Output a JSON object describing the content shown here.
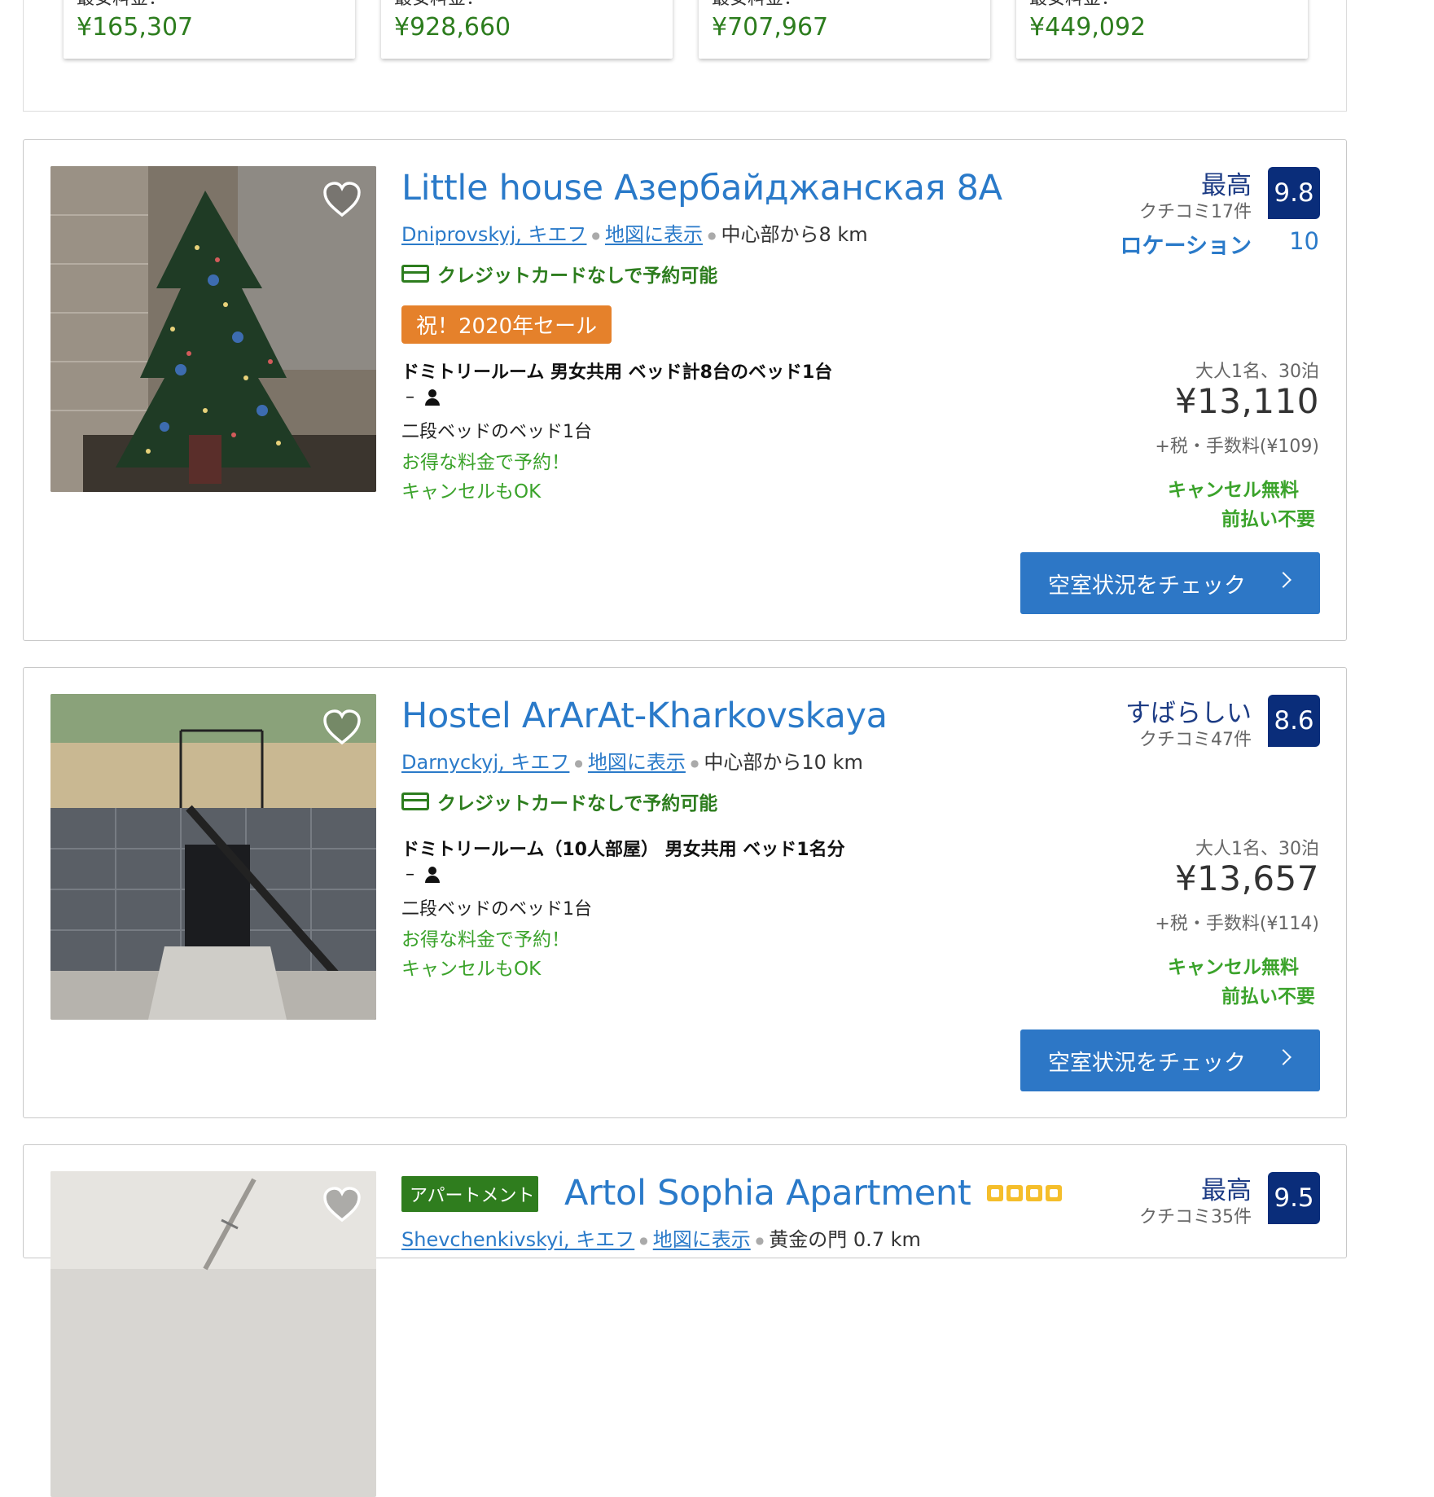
{
  "top_prices": [
    {
      "label": "最安料金：",
      "value": "¥165,307"
    },
    {
      "label": "最安料金：",
      "value": "¥928,660"
    },
    {
      "label": "最安料金：",
      "value": "¥707,967"
    },
    {
      "label": "最安料金：",
      "value": "¥449,092"
    }
  ],
  "properties": [
    {
      "title": "Little house Азербайджанская 8А",
      "district": "Dniprovskyj, キエフ",
      "map_link": "地図に表示",
      "distance": "中心部から8 km",
      "credit_note": "クレジットカードなしで予約可能",
      "sale_badge": "祝！2020年セール",
      "score_word": "最高",
      "review_count": "クチコミ17件",
      "score": "9.8",
      "location_label": "ロケーション",
      "location_score": "10",
      "room_name": "ドミトリールーム 男女共用 ベッド計8台のベッド1台",
      "occupancy_prefix": "–",
      "bed_type": "二段ベッドのベッド1台",
      "deal_text": "お得な料金で予約！",
      "cancel_text": "キャンセルもOK",
      "guests": "大人1名、30泊",
      "price": "¥13,110",
      "tax": "+税・手数料(¥109)",
      "free_cancel": "キャンセル無料",
      "no_prepay": "前払い不要",
      "cta": "空室状況をチェック"
    },
    {
      "title": "Hostel ArArAt-Kharkovskaya",
      "district": "Darnyckyj, キエフ",
      "map_link": "地図に表示",
      "distance": "中心部から10 km",
      "credit_note": "クレジットカードなしで予約可能",
      "score_word": "すばらしい",
      "review_count": "クチコミ47件",
      "score": "8.6",
      "room_name": "ドミトリールーム（10人部屋） 男女共用 ベッド1名分",
      "occupancy_prefix": "–",
      "bed_type": "二段ベッドのベッド1台",
      "deal_text": "お得な料金で予約！",
      "cancel_text": "キャンセルもOK",
      "guests": "大人1名、30泊",
      "price": "¥13,657",
      "tax": "+税・手数料(¥114)",
      "free_cancel": "キャンセル無料",
      "no_prepay": "前払い不要",
      "cta": "空室状況をチェック"
    },
    {
      "type_badge": "アパートメント",
      "title": "Artol Sophia Apartment",
      "star_rating": 4,
      "district": "Shevchenkivskyi, キエフ",
      "map_link": "地図に表示",
      "distance": "黄金の門 0.7 km",
      "score_word": "最高",
      "review_count": "クチコミ35件",
      "score": "9.5"
    }
  ],
  "colors": {
    "link_blue": "#2a7ac9",
    "score_navy": "#0a2d7a",
    "deal_green": "#3ba32b",
    "credit_green": "#2d7d1e",
    "sale_orange": "#e5812b",
    "cta_blue": "#2d77c6"
  },
  "icons": [
    "heart-icon",
    "credit-card-icon",
    "person-icon",
    "chevron-right-icon",
    "star-icon"
  ]
}
